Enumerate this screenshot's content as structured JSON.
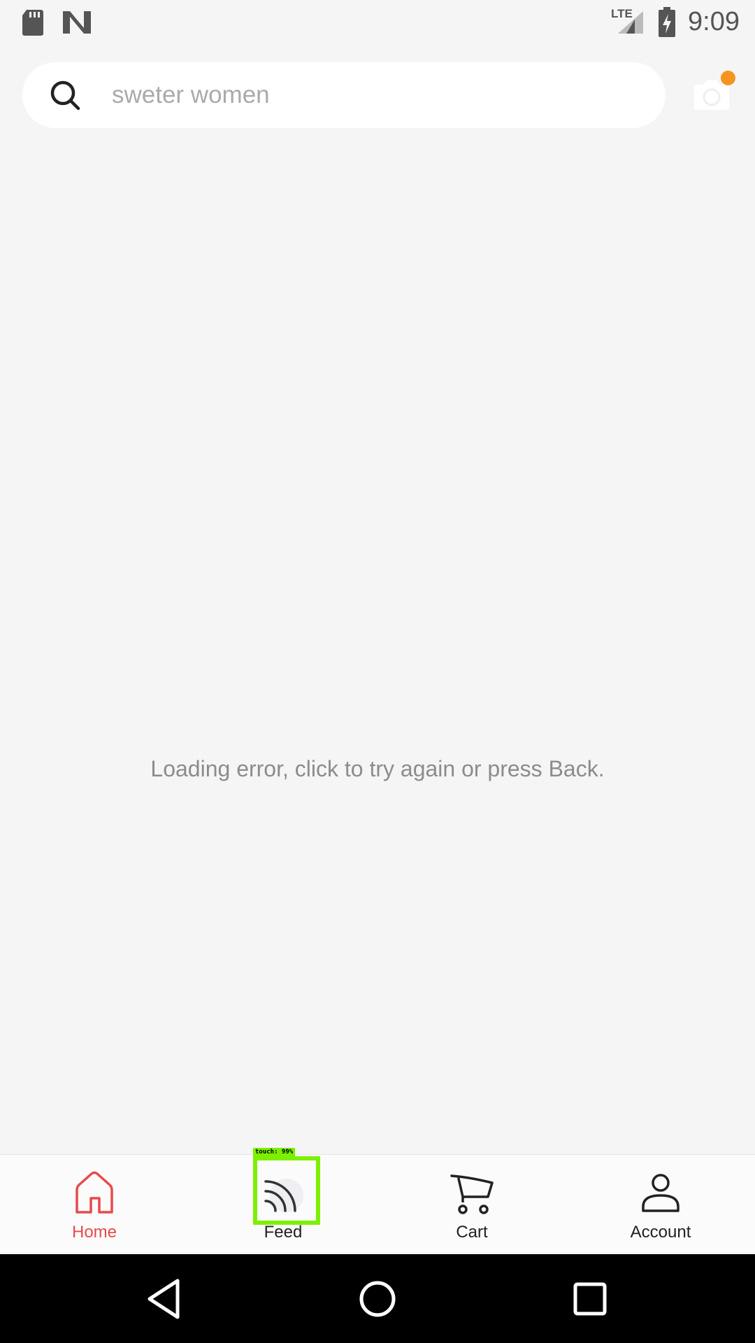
{
  "status_bar": {
    "time": "9:09",
    "network_label": "LTE",
    "icons": [
      "sd-card-icon",
      "n-logo-icon",
      "signal-icon",
      "battery-charging-icon"
    ]
  },
  "search": {
    "placeholder": "sweter women",
    "icon": "search-icon",
    "camera_icon": "camera-icon",
    "badge_color": "#f5941f"
  },
  "main": {
    "error_message": "Loading error, click to try again or press Back."
  },
  "tabs": [
    {
      "label": "Home",
      "icon": "home-icon",
      "active": true
    },
    {
      "label": "Feed",
      "icon": "feed-icon",
      "active": false
    },
    {
      "label": "Cart",
      "icon": "cart-icon",
      "active": false
    },
    {
      "label": "Account",
      "icon": "account-icon",
      "active": false
    }
  ],
  "touch_overlay": {
    "label": "touch: 99%"
  },
  "nav_bar": {
    "buttons": [
      "back-icon",
      "home-circle-icon",
      "recents-icon"
    ]
  },
  "colors": {
    "accent": "#e84a4a",
    "background": "#f5f5f5",
    "touch_highlight": "#7cf000"
  }
}
